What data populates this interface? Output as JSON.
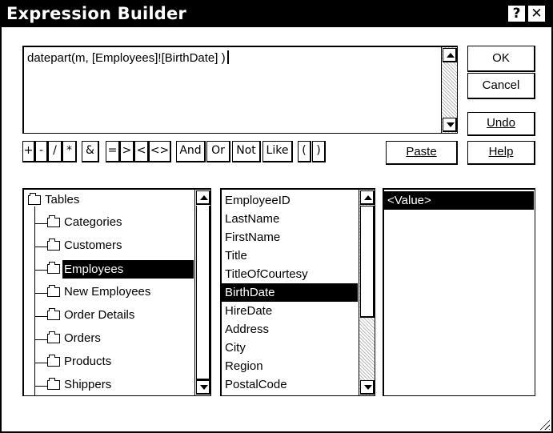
{
  "window": {
    "title": "Expression Builder",
    "help_glyph": "?",
    "close_glyph": "✕"
  },
  "expression": {
    "value": "datepart(m, [Employees]![BirthDate] )"
  },
  "buttons": {
    "ok": "OK",
    "cancel": "Cancel",
    "undo": "Undo",
    "paste": "Paste",
    "help": "Help"
  },
  "operators": [
    "+",
    "-",
    "/",
    "*",
    "&",
    "=",
    ">",
    "<",
    "<>",
    "And",
    "Or",
    "Not",
    "Like",
    "(",
    ")"
  ],
  "tree": {
    "root": "Tables",
    "items": [
      "Categories",
      "Customers",
      "Employees",
      "New Employees",
      "Order Details",
      "Orders",
      "Products",
      "Shippers"
    ],
    "selected": "Employees"
  },
  "fields": {
    "items": [
      "EmployeeID",
      "LastName",
      "FirstName",
      "Title",
      "TitleOfCourtesy",
      "BirthDate",
      "HireDate",
      "Address",
      "City",
      "Region",
      "PostalCode"
    ],
    "selected": "BirthDate"
  },
  "values": {
    "items": [
      "<Value>"
    ],
    "selected": "<Value>"
  },
  "icons": {
    "folder": "folder-icon",
    "open_folder": "open-folder-icon",
    "scroll_up": "scroll-up-arrow-icon",
    "scroll_down": "scroll-down-arrow-icon",
    "resize_grip": "resize-grip-icon"
  }
}
